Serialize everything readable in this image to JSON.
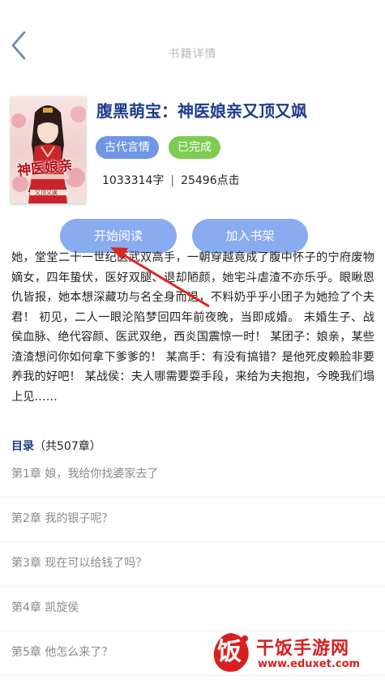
{
  "header": {
    "title": "书籍详情",
    "back_icon": "chevron-left-icon"
  },
  "book": {
    "title": "腹黑萌宝：神医娘亲又顶又飒",
    "cover_text": "神医娘亲",
    "cover_subtitle": "又顶又飒",
    "genre": "古代言情",
    "status": "已完成",
    "words": "1033314字",
    "separator": "|",
    "clicks": "25496点击"
  },
  "actions": {
    "read_label": "开始阅读",
    "shelf_label": "加入书架"
  },
  "synopsis": "她，堂堂二十一世纪医武双高手，一朝穿越竟成了腹中怀子的宁府废物嫡女，四年蛰伏，医好双腿、退却陋颜，她宅斗虐渣不亦乐乎。眼瞅恩仇皆报，她本想深藏功与名全身而退，不料奶乎乎小团子为她捡了个夫君！ 初见，二人一眼沦陷梦回四年前夜晚，当即成婚。 未婚生子、战侯血脉、绝代容颜、医武双绝，西炎国震惊一时！ 某团子：娘亲，某些渣渣想问你如何拿下爹爹的！ 某高手：有没有搞错？是他死皮赖脸非要养我的好吧！ 某战侯：夫人哪需要耍手段，来给为夫抱抱，今晚我们塌上见……",
  "toc": {
    "label": "目录",
    "count": "（共507章）"
  },
  "chapters": [
    "第1章 娘，我给你找婆家去了",
    "第2章 我的银子呢？",
    "第3章 现在可以给钱了吗？",
    "第4章 凯旋侯",
    "第5章 他怎么来了？"
  ],
  "watermark": {
    "name": "干饭手游网",
    "url": "www.eduxet.com",
    "logo_char": "饭"
  },
  "colors": {
    "title_blue": "#1f3c8a",
    "genre_tag": "#6f96e6",
    "status_tag": "#7ecb52",
    "button": "#89abf0",
    "annotation_red": "#e0261f",
    "watermark_red": "#d91e1e"
  }
}
